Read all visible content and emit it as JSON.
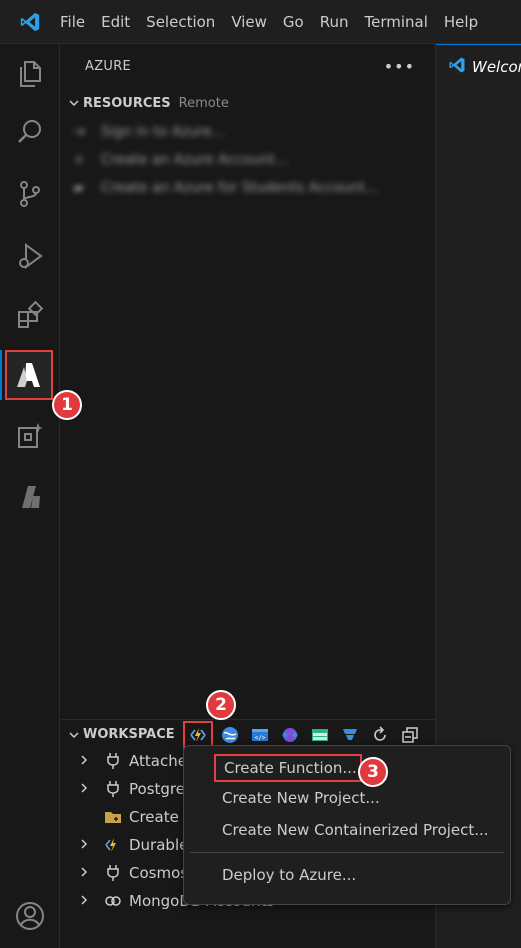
{
  "menu": [
    "File",
    "Edit",
    "Selection",
    "View",
    "Go",
    "Run",
    "Terminal",
    "Help"
  ],
  "sidebar": {
    "title": "AZURE",
    "resources": {
      "label": "RESOURCES",
      "description": "Remote",
      "items": [
        "Sign in to Azure...",
        "Create an Azure Account...",
        "Create an Azure for Students Account..."
      ]
    },
    "workspace": {
      "label": "WORKSPACE",
      "items": [
        "Attached",
        "Postgres",
        "Create",
        "Durable",
        "Cosmos",
        "MongoDB Accounts"
      ]
    }
  },
  "editor": {
    "tab_label": "Welcome"
  },
  "context_menu": {
    "items": [
      "Create Function...",
      "Create New Project...",
      "Create New Containerized Project...",
      "Deploy to Azure..."
    ]
  },
  "badges": [
    "1",
    "2",
    "3"
  ],
  "account_badge": "1",
  "colors": {
    "accent": "#0078d4",
    "highlight": "#e04040",
    "background": "#181818"
  }
}
